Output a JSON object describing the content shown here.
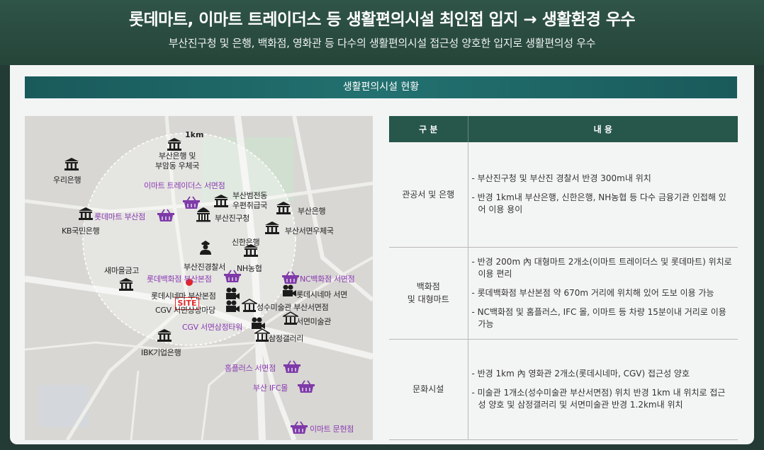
{
  "header": {
    "title": "롯데마트, 이마트 트레이더스 등 생활편의시설 최인접 입지 → 생활환경 우수",
    "subtitle": "부산진구청 및 은행, 백화점, 영화관 등 다수의 생활편의시설 접근성 양호한 입지로 생활편의성 우수"
  },
  "section": {
    "title": "생활편의시설 현황"
  },
  "map": {
    "radius_label": "1km",
    "site_label": "SITE",
    "markers": [
      {
        "id": "bank-busan",
        "label": "부산은행 및\n부암동 우체국",
        "icon": "bank-icon",
        "color": "black"
      },
      {
        "id": "woori",
        "label": "우리은행",
        "icon": "bank-icon",
        "color": "black"
      },
      {
        "id": "emart-traders",
        "label": "이마트 트레이더스 서면점",
        "icon": "shopping-basket-icon",
        "color": "purple"
      },
      {
        "id": "busan-court-post",
        "label": "부산범전동\n우편취급국",
        "icon": "bank-icon",
        "color": "black"
      },
      {
        "id": "busan-bank2",
        "label": "부산은행",
        "icon": "bank-icon",
        "color": "black"
      },
      {
        "id": "kb",
        "label": "KB국민은행",
        "icon": "bank-icon",
        "color": "black"
      },
      {
        "id": "lotte-mart",
        "label": "롯데마트 부산점",
        "icon": "shopping-basket-icon",
        "color": "purple"
      },
      {
        "id": "busanjin-gu-office",
        "label": "부산진구청",
        "icon": "government-icon",
        "color": "black"
      },
      {
        "id": "seomyeon-post",
        "label": "부산서면우체국",
        "icon": "bank-icon",
        "color": "black"
      },
      {
        "id": "shinhan",
        "label": "신한은행",
        "icon": "bank-icon",
        "color": "black"
      },
      {
        "id": "police",
        "label": "부산진경찰서",
        "icon": "police-icon",
        "color": "black"
      },
      {
        "id": "nh",
        "label": "NH농협",
        "icon": "bank-icon",
        "color": "black"
      },
      {
        "id": "saemaeul",
        "label": "새마을금고",
        "icon": "bank-icon",
        "color": "black"
      },
      {
        "id": "lotte-dept",
        "label": "롯데백화점 부산본점",
        "icon": "shopping-basket-icon",
        "color": "purple"
      },
      {
        "id": "nc-dept",
        "label": "NC백화점 서면점",
        "icon": "shopping-basket-icon",
        "color": "purple"
      },
      {
        "id": "lotte-cinema",
        "label": "롯데시네마 서면",
        "icon": "cinema-icon",
        "color": "black"
      },
      {
        "id": "lotte-cinema-busan",
        "label": "롯데시네마 부산본점",
        "icon": "cinema-icon",
        "color": "black"
      },
      {
        "id": "sungsu-museum",
        "label": "성수미술관 부산서면점",
        "icon": "museum-icon",
        "color": "black"
      },
      {
        "id": "cgv-sangsang",
        "label": "CGV 서면상상마당",
        "icon": "cinema-icon",
        "color": "black"
      },
      {
        "id": "seomyeon-museum",
        "label": "서면미술관",
        "icon": "museum-icon",
        "color": "black"
      },
      {
        "id": "cgv-samjeong",
        "label": "CGV 서면삼정타워",
        "icon": "cinema-icon",
        "color": "purple"
      },
      {
        "id": "samjeong-gallery",
        "label": "삼정갤러리",
        "icon": "museum-icon",
        "color": "black"
      },
      {
        "id": "ibk",
        "label": "IBK기업은행",
        "icon": "bank-icon",
        "color": "black"
      },
      {
        "id": "homeplus",
        "label": "홈플러스 서면점",
        "icon": "shopping-basket-icon",
        "color": "purple"
      },
      {
        "id": "ifc-mall",
        "label": "부산 IFC몰",
        "icon": "shopping-basket-icon",
        "color": "purple"
      },
      {
        "id": "emart-munhyeon",
        "label": "이마트 문현점",
        "icon": "shopping-basket-icon",
        "color": "purple"
      }
    ]
  },
  "table": {
    "headers": [
      "구 분",
      "내 용"
    ],
    "rows": [
      {
        "category": "관공서 및 은행",
        "items": [
          "- 부산진구청 및 부산진 경찰서 반경 300m내 위치",
          "- 반경 1km내 부산은행, 신한은행, NH농협 등 다수 금융기관 인접해 있어 이용 용이"
        ]
      },
      {
        "category": "백화점\n및 대형마트",
        "items": [
          "- 반경 200m 內 대형마트 2개소(이마트 트레이더스 및 롯데마트) 위치로 이용 편리",
          "- 롯데백화점 부산본점 약 670m 거리에 위치해 있어 도보 이용 가능",
          "- NC백화점 및 홈플러스, IFC 몰, 이마트 등 차량 15분이내 거리로 이용 가능"
        ]
      },
      {
        "category": "문화시설",
        "items": [
          "- 반경 1km 內 영화관 2개소(롯데시네마, CGV) 접근성 양호",
          "- 미술관 1개소(성수미술관 부산서면점) 위치 반경 1km 내 위치로 접근성 양호 및 삼정갤러리 및 서면미술관 반경 1.2km내 위치"
        ]
      }
    ]
  },
  "colors": {
    "header_bg": "#2c4f44",
    "section_bar": "#1f6766",
    "table_header": "#27564b",
    "site_red": "#e0262a",
    "purple": "#8a3ab3",
    "basket_purple": "#7e3aa8"
  }
}
